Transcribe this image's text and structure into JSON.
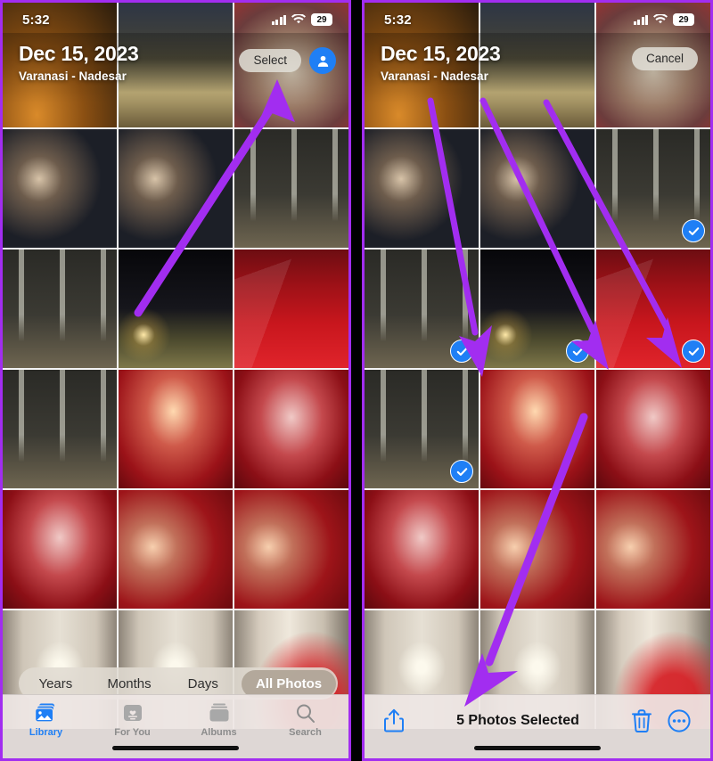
{
  "accent": {
    "arrow_purple": "#a22df0",
    "ios_blue": "#1f7ff5",
    "border_purple": "#a22df0"
  },
  "panels": [
    {
      "id": "left",
      "statusbar": {
        "time": "5:32",
        "battery": "29",
        "cellular_icon": "signal-bars-icon",
        "wifi_icon": "wifi-icon"
      },
      "header": {
        "date": "Dec 15, 2023",
        "location": "Varanasi - Nadesar",
        "action_label": "Select",
        "avatar_icon": "person-avatar-icon"
      },
      "segmented": {
        "options": [
          "Years",
          "Months",
          "Days",
          "All Photos"
        ],
        "selected": "All Photos"
      },
      "tabbar": [
        {
          "label": "Library",
          "icon": "photo-stack-icon",
          "active": true
        },
        {
          "label": "For You",
          "icon": "for-you-card-icon",
          "active": false
        },
        {
          "label": "Albums",
          "icon": "albums-stack-icon",
          "active": false
        },
        {
          "label": "Search",
          "icon": "search-icon",
          "active": false
        }
      ]
    },
    {
      "id": "right",
      "statusbar": {
        "time": "5:32",
        "battery": "29",
        "cellular_icon": "signal-bars-icon",
        "wifi_icon": "wifi-icon"
      },
      "header": {
        "date": "Dec 15, 2023",
        "location": "Varanasi - Nadesar",
        "action_label": "Cancel"
      },
      "selection_toolbar": {
        "share_icon": "share-up-arrow-icon",
        "count_label": "5 Photos Selected",
        "delete_icon": "trash-icon",
        "more_icon": "more-ellipsis-circle-icon"
      }
    }
  ],
  "photo_grid": {
    "rows": 6,
    "columns": 3,
    "cells": [
      {
        "style": "ph-ghat",
        "alt": "ghat-at-night",
        "selected_right": false
      },
      {
        "style": "ph-ghat2",
        "alt": "varanasi-steps",
        "selected_right": false
      },
      {
        "style": "ph-shrine",
        "alt": "street-shrine",
        "selected_right": false
      },
      {
        "style": "ph-blur",
        "alt": "blurred-portrait-one",
        "selected_right": false
      },
      {
        "style": "ph-blur",
        "alt": "blurred-portrait-two",
        "selected_right": false
      },
      {
        "style": "ph-chand",
        "alt": "hanging-lights",
        "selected_right": true
      },
      {
        "style": "ph-chand",
        "alt": "lit-pathway",
        "selected_right": true
      },
      {
        "style": "ph-night",
        "alt": "garden-at-night",
        "selected_right": true
      },
      {
        "style": "ph-carpet",
        "alt": "red-carpet-aisle",
        "selected_right": true
      },
      {
        "style": "ph-chand",
        "alt": "crystal-pillars",
        "selected_right": true
      },
      {
        "style": "ph-hall2",
        "alt": "groom-in-hall",
        "selected_right": false
      },
      {
        "style": "ph-hall",
        "alt": "couple-on-carpet",
        "selected_right": false
      },
      {
        "style": "ph-hall",
        "alt": "stage-chandelier",
        "selected_right": false
      },
      {
        "style": "ph-selfie",
        "alt": "group-selfie-one",
        "selected_right": false
      },
      {
        "style": "ph-selfie",
        "alt": "group-selfie-two",
        "selected_right": false
      },
      {
        "style": "ph-corridor",
        "alt": "hotel-corridor-one",
        "selected_right": false
      },
      {
        "style": "ph-corridor",
        "alt": "hotel-corridor-two",
        "selected_right": false
      },
      {
        "style": "ph-corridor-red",
        "alt": "corridor-with-guest",
        "selected_right": false
      }
    ]
  },
  "annotations": {
    "left_arrow": {
      "name": "arrow-to-select-button",
      "points_to": "Select"
    },
    "right_arrows": [
      {
        "name": "arrow-to-photo-1",
        "points_to": "checkmark row 3 col 1"
      },
      {
        "name": "arrow-to-photo-2",
        "points_to": "checkmark row 3 col 2"
      },
      {
        "name": "arrow-to-photo-3",
        "points_to": "checkmark row 3 col 3"
      },
      {
        "name": "arrow-to-share-button",
        "points_to": "share icon"
      }
    ]
  }
}
